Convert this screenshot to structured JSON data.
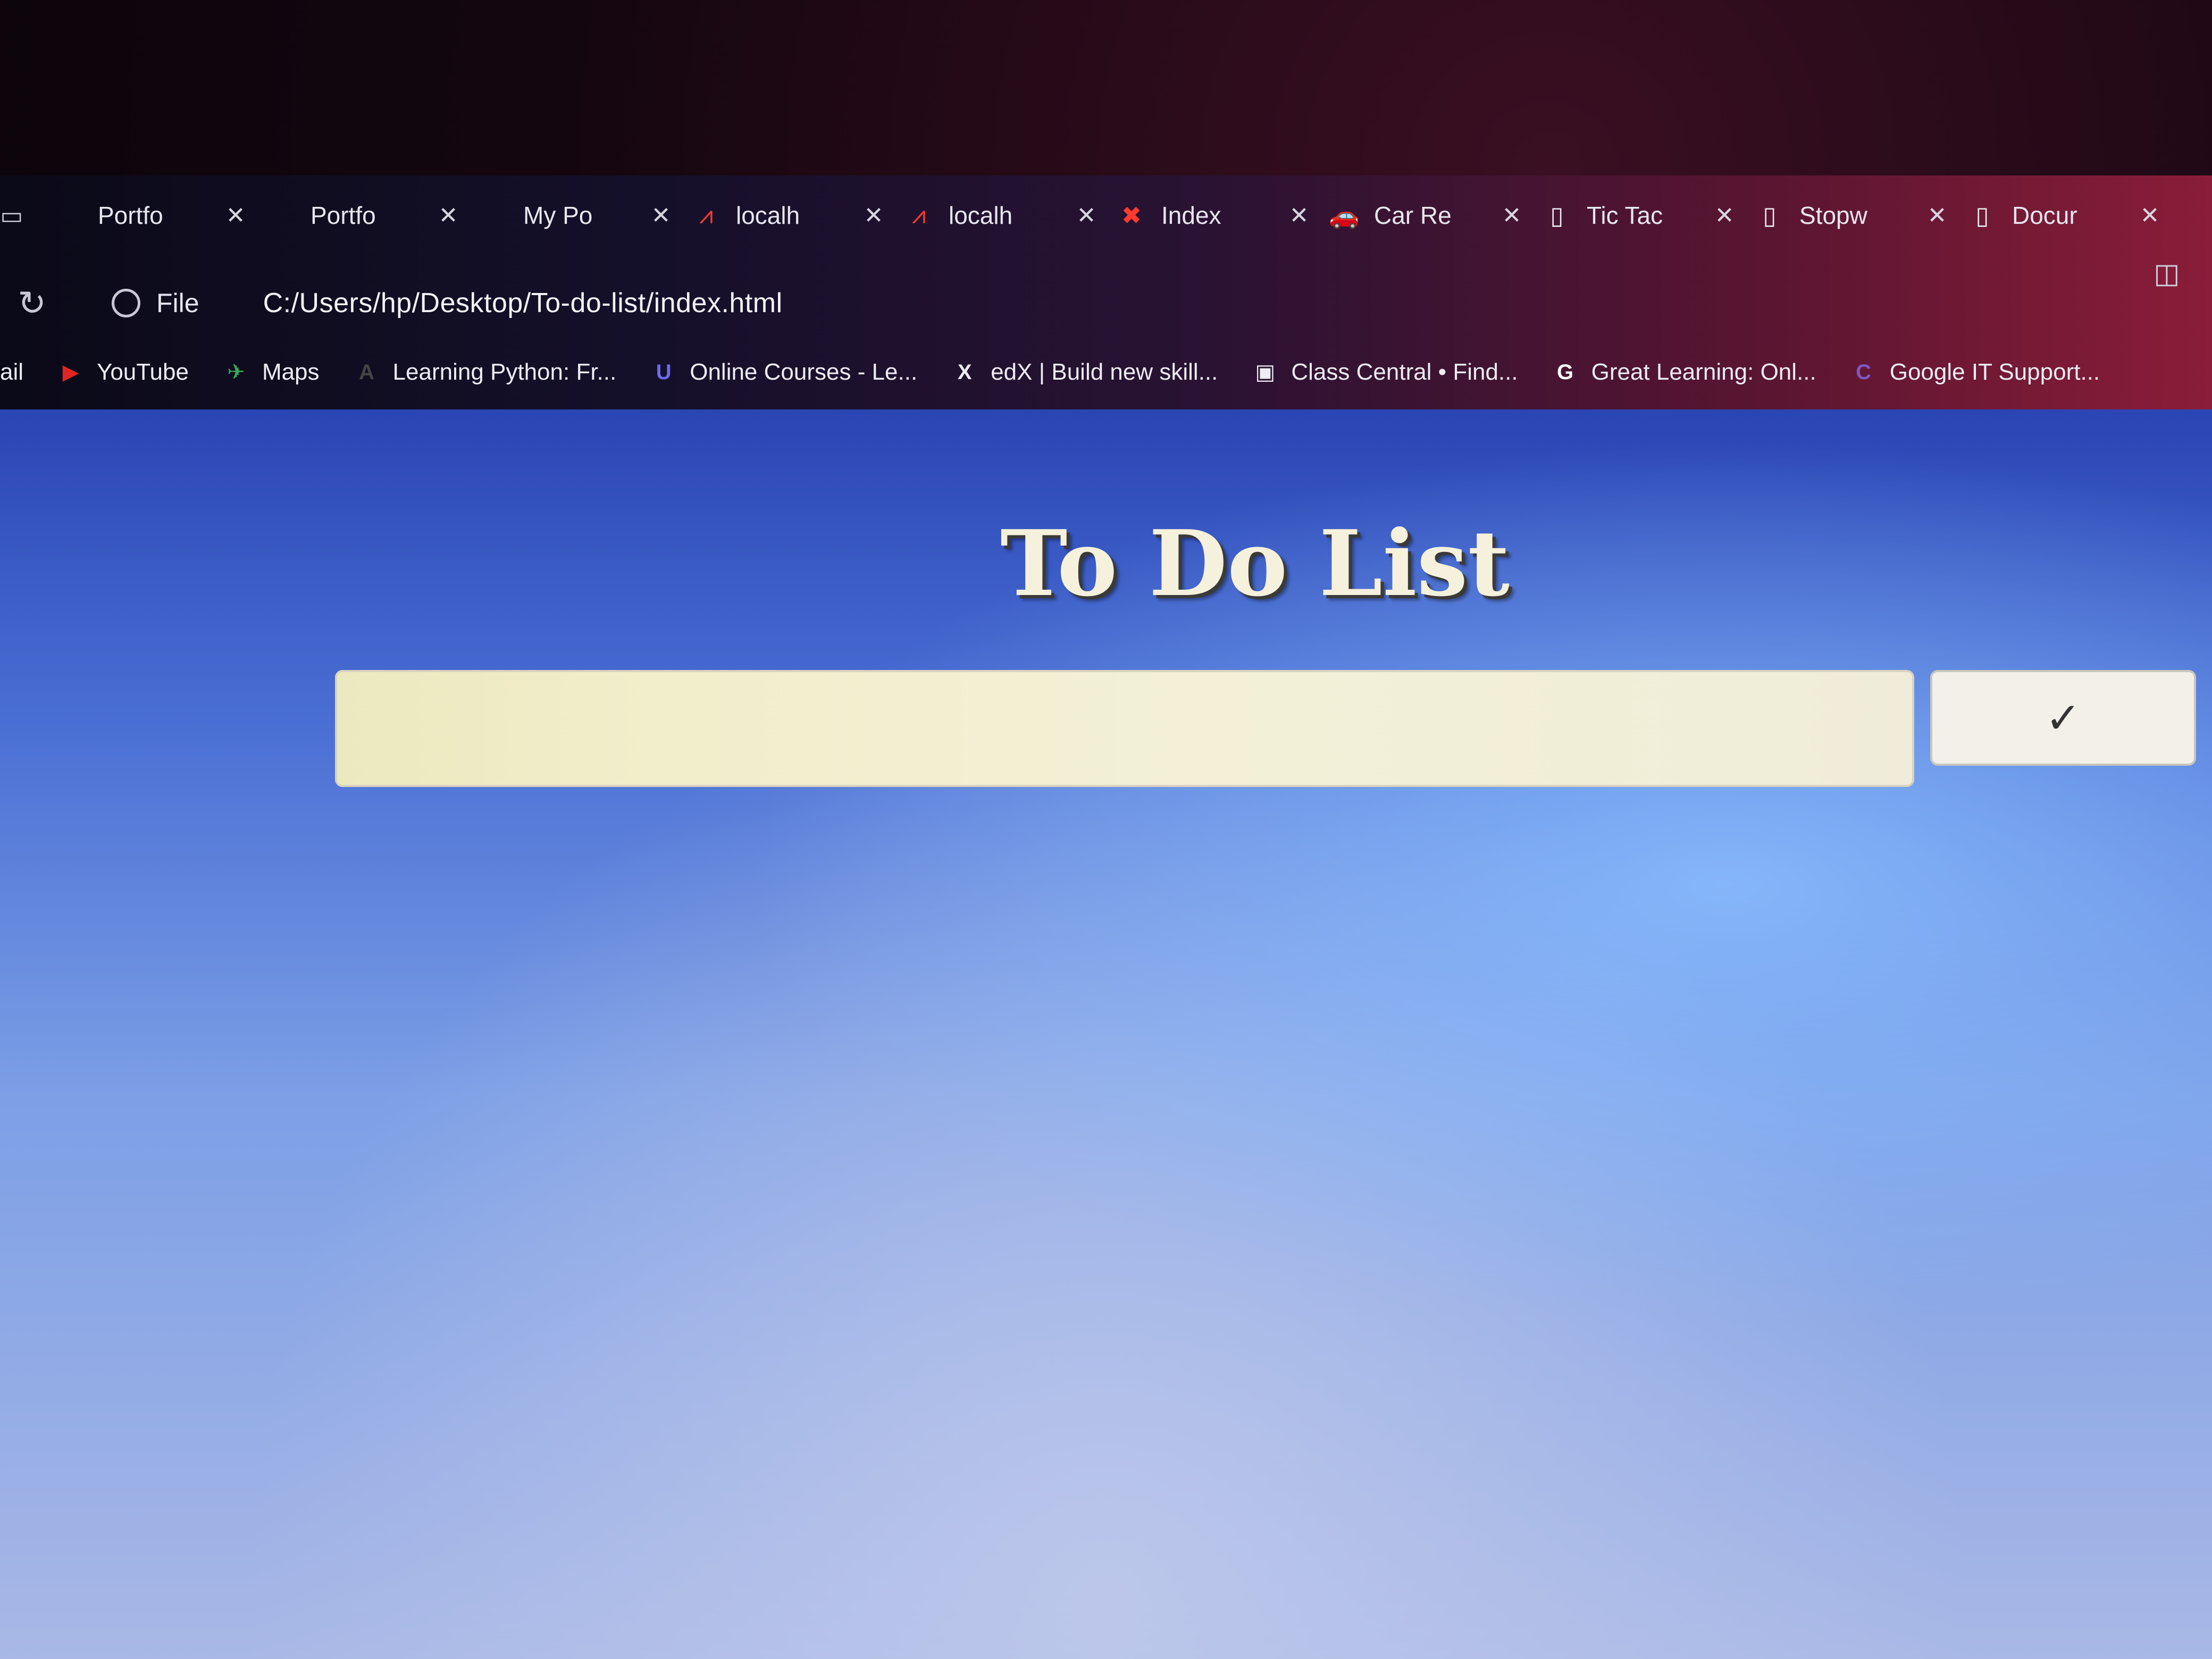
{
  "browser": {
    "tabs": [
      {
        "label": "Portfo",
        "icon": "tab-blank-icon"
      },
      {
        "label": "Portfo",
        "icon": "tab-blank-icon"
      },
      {
        "label": "My Po",
        "icon": "tab-blank-icon"
      },
      {
        "label": "localh",
        "icon": "localhost-icon"
      },
      {
        "label": "localh",
        "icon": "localhost-icon"
      },
      {
        "label": "Index",
        "icon": "xampp-icon"
      },
      {
        "label": "Car Re",
        "icon": "car-icon"
      },
      {
        "label": "Tic Tac",
        "icon": "document-icon"
      },
      {
        "label": "Stopw",
        "icon": "document-icon"
      },
      {
        "label": "Docur",
        "icon": "document-icon"
      }
    ],
    "tab_close_glyph": "✕",
    "address": {
      "site_info_label": "File",
      "url": "C:/Users/hp/Desktop/To-do-list/index.html"
    },
    "bookmarks": [
      {
        "label": "ail",
        "icon": "",
        "color": ""
      },
      {
        "label": "YouTube",
        "icon": "▶",
        "color": "#e02424"
      },
      {
        "label": "Maps",
        "icon": "✈",
        "color": "#3aa757"
      },
      {
        "label": "Learning Python: Fr...",
        "icon": "A",
        "color": "#444444"
      },
      {
        "label": "Online Courses - Le...",
        "icon": "U",
        "color": "#6a6cf0"
      },
      {
        "label": "edX | Build new skill...",
        "icon": "X",
        "color": ""
      },
      {
        "label": "Class Central • Find...",
        "icon": "▣",
        "color": ""
      },
      {
        "label": "Great Learning: Onl...",
        "icon": "G",
        "color": "#ffffff"
      },
      {
        "label": "Google IT Support...",
        "icon": "C",
        "color": "#7e57c2"
      }
    ]
  },
  "page": {
    "title": "To Do List",
    "input_value": "",
    "add_button_glyph": "✓"
  },
  "colors": {
    "title_text": "#f6f1dc",
    "input_bg": "#f1eecb",
    "page_bg_top": "#2a45b4",
    "page_bg_bottom": "#a9b8e6"
  }
}
